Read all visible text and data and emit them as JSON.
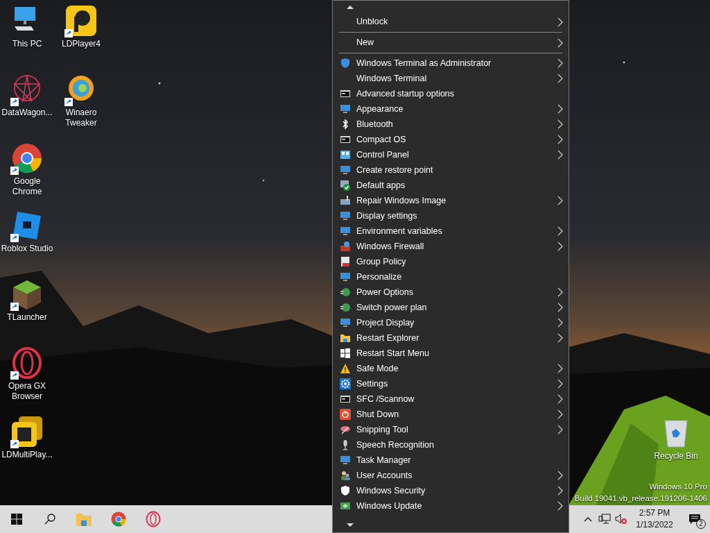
{
  "desktop_icons": [
    {
      "label": "This PC",
      "shortcut": false
    },
    {
      "label": "LDPlayer4",
      "shortcut": true
    },
    {
      "label": "DataWagon...",
      "shortcut": true
    },
    {
      "label": "Winaero Tweaker",
      "shortcut": true
    },
    {
      "label": "Google Chrome",
      "shortcut": true
    },
    {
      "label": "Roblox Studio",
      "shortcut": true
    },
    {
      "label": "TLauncher",
      "shortcut": true
    },
    {
      "label": "Opera GX Browser",
      "shortcut": true
    },
    {
      "label": "LDMultiPlay...",
      "shortcut": true
    },
    {
      "label": "Recycle Bin",
      "shortcut": false
    }
  ],
  "context_menu": {
    "sections": [
      [
        {
          "label": "Unblock",
          "submenu": true
        }
      ],
      [
        {
          "label": "New",
          "submenu": true
        }
      ],
      [
        {
          "label": "Windows Terminal as Administrator",
          "submenu": true
        },
        {
          "label": "Windows Terminal",
          "submenu": true
        },
        {
          "label": "Advanced startup options",
          "submenu": false
        },
        {
          "label": "Appearance",
          "submenu": true
        },
        {
          "label": "Bluetooth",
          "submenu": true
        },
        {
          "label": "Compact OS",
          "submenu": true
        },
        {
          "label": "Control Panel",
          "submenu": true
        },
        {
          "label": "Create restore point",
          "submenu": false
        },
        {
          "label": "Default apps",
          "submenu": false
        },
        {
          "label": "Repair Windows Image",
          "submenu": true
        },
        {
          "label": "Display settings",
          "submenu": false
        },
        {
          "label": "Environment variables",
          "submenu": true
        },
        {
          "label": "Windows Firewall",
          "submenu": true
        },
        {
          "label": "Group Policy",
          "submenu": false
        },
        {
          "label": "Personalize",
          "submenu": false
        },
        {
          "label": "Power Options",
          "submenu": true
        },
        {
          "label": "Switch power plan",
          "submenu": true
        },
        {
          "label": "Project Display",
          "submenu": true
        },
        {
          "label": "Restart Explorer",
          "submenu": true
        },
        {
          "label": "Restart Start Menu",
          "submenu": false
        },
        {
          "label": "Safe Mode",
          "submenu": true
        },
        {
          "label": "Settings",
          "submenu": true
        },
        {
          "label": "SFC /Scannow",
          "submenu": true
        },
        {
          "label": "Shut Down",
          "submenu": true
        },
        {
          "label": "Snipping Tool",
          "submenu": true
        },
        {
          "label": "Speech Recognition",
          "submenu": false
        },
        {
          "label": "Task Manager",
          "submenu": false
        },
        {
          "label": "User Accounts",
          "submenu": true
        },
        {
          "label": "Windows Security",
          "submenu": true
        },
        {
          "label": "Windows Update",
          "submenu": true
        }
      ]
    ]
  },
  "os_watermark": {
    "edition": "Windows 10 Pro",
    "build": "Build 19041.vb_release.191206-1406"
  },
  "taskbar": {
    "time": "2:57 PM",
    "date": "1/13/2022",
    "notification_count": "2"
  }
}
